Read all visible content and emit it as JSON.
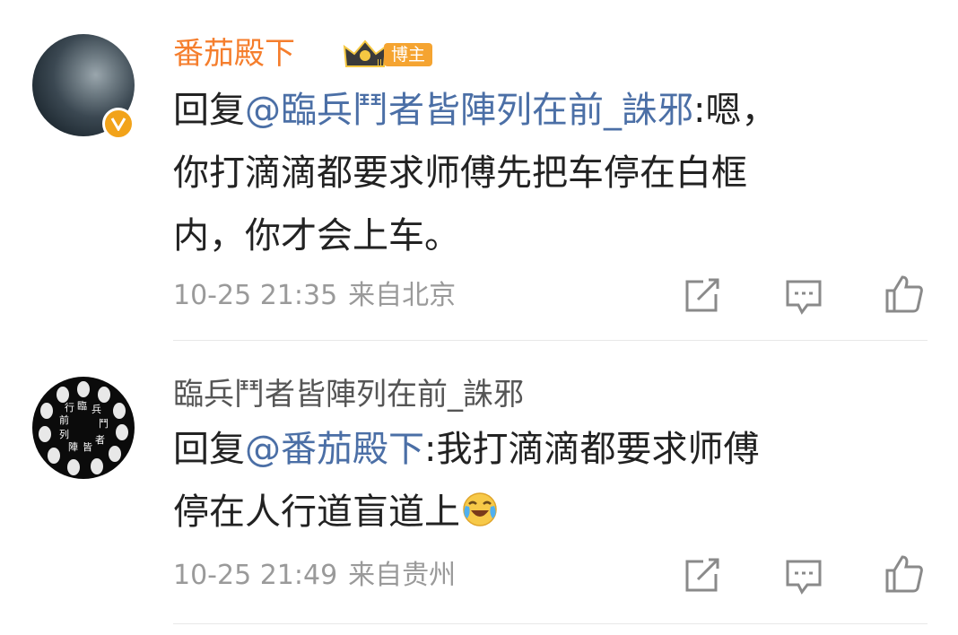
{
  "comments": [
    {
      "username": "番茄殿下",
      "badge_label": "博主",
      "reply_prefix": "回复",
      "mention": "@臨兵鬥者皆陣列在前_誅邪",
      "text_line1_rest": ":嗯，",
      "text_line2": "你打滴滴都要求师傅先把车停在白框",
      "text_line3": "内，你才会上车。",
      "date": "10-25 21:35",
      "location": "来自北京"
    },
    {
      "username": "臨兵鬥者皆陣列在前_誅邪",
      "avatar_text": "臨兵鬥者皆陣列在前行",
      "reply_prefix": "回复",
      "mention": "@番茄殿下",
      "text_line1_rest": ":我打滴滴都要求师傅",
      "text_line2": "停在人行道盲道上",
      "emoji": "laugh-cry-emoji",
      "date": "10-25 21:49",
      "location": "来自贵州"
    }
  ],
  "colors": {
    "vip_name": "#f57e2d",
    "mention": "#4b6fa6",
    "meta": "#9a9a9a",
    "badge": "#f5a431"
  },
  "icons": [
    "share-icon",
    "comment-icon",
    "like-icon"
  ]
}
